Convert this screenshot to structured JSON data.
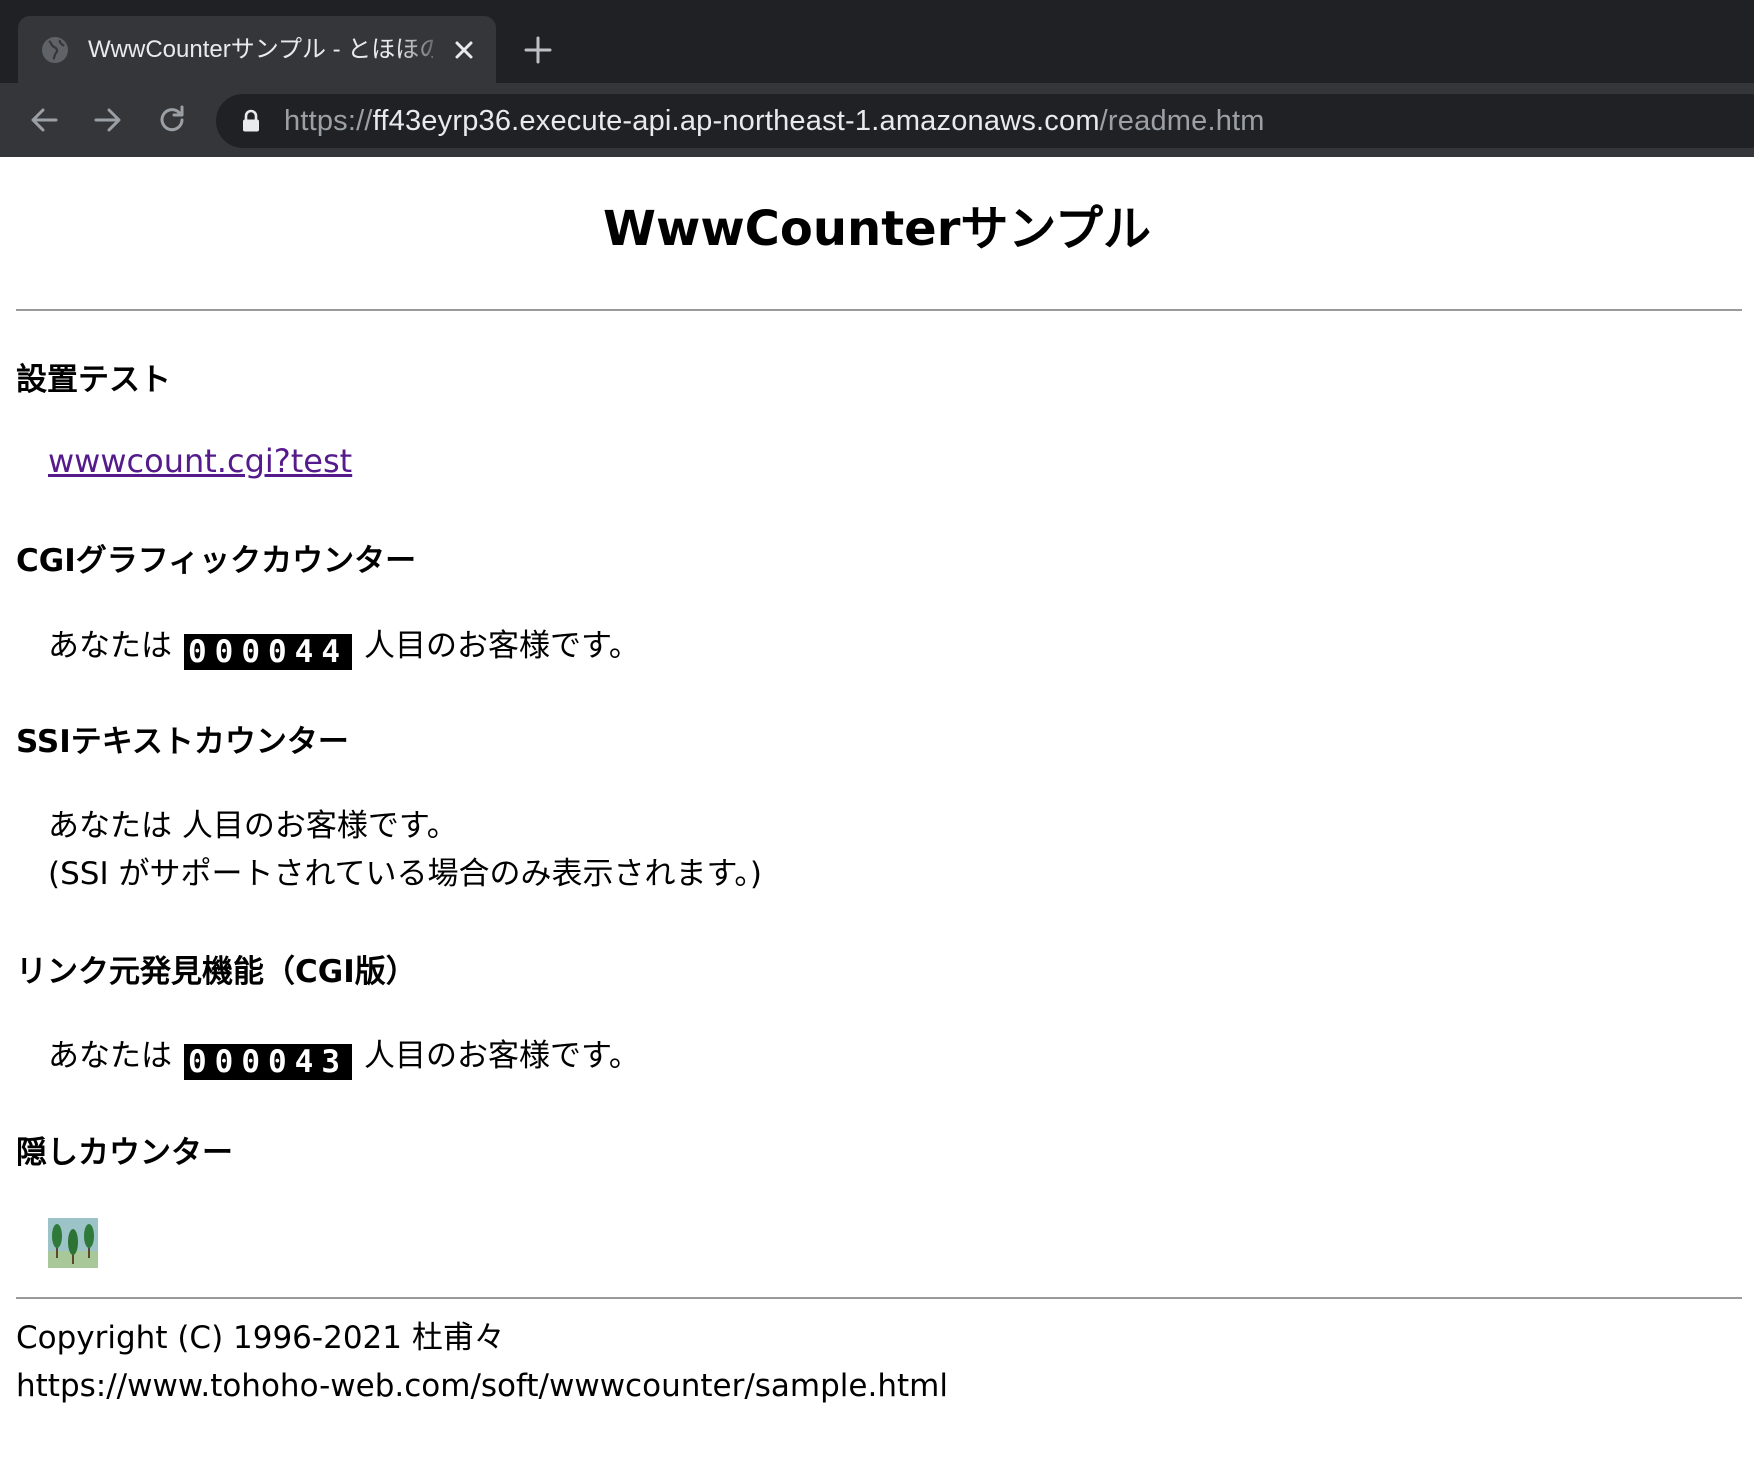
{
  "browser": {
    "tab": {
      "title": "WwwCounterサンプル - とほほのWWW入門",
      "favicon": "globe-icon",
      "close_icon": "close-icon"
    },
    "new_tab_icon": "plus-icon",
    "nav": {
      "back_icon": "arrow-left-icon",
      "forward_icon": "arrow-right-icon",
      "reload_icon": "reload-icon"
    },
    "address_bar": {
      "lock_icon": "lock-icon",
      "scheme": "https://",
      "host": "ff43eyrp36.execute-api.ap-northeast-1.amazonaws.com",
      "path": "/readme.htm"
    }
  },
  "page": {
    "title": "WwwCounterサンプル",
    "sections": {
      "install_test": {
        "heading": "設置テスト",
        "link_text": "wwwcount.cgi?test"
      },
      "cgi_graphic": {
        "heading": "CGIグラフィックカウンター",
        "prefix": "あなたは",
        "counter": "000044",
        "suffix": "人目のお客様です。"
      },
      "ssi_text": {
        "heading": "SSIテキストカウンター",
        "line1": "あなたは 人目のお客様です。",
        "line2": "(SSI がサポートされている場合のみ表示されます。)"
      },
      "referer": {
        "heading": "リンク元発見機能（CGI版）",
        "prefix": "あなたは",
        "counter": "000043",
        "suffix": "人目のお客様です。"
      },
      "hidden": {
        "heading": "隠しカウンター",
        "image_icon": "trees-image"
      }
    },
    "footer": {
      "copyright": "Copyright (C) 1996-2021 杜甫々",
      "url": "https://www.tohoho-web.com/soft/wwwcounter/sample.html"
    }
  },
  "colors": {
    "chrome_dark": "#202124",
    "chrome_tab": "#35363a",
    "link_visited": "#551a8b",
    "counter_bg": "#000000"
  }
}
